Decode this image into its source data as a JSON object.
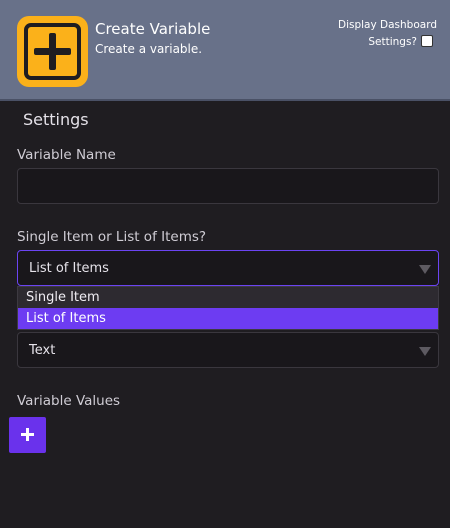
{
  "header": {
    "title": "Create Variable",
    "subtitle": "Create a variable.",
    "icon": "add-square-icon",
    "icon_color": "#fbb11a",
    "display_dashboard_label_line1": "Display Dashboard",
    "display_dashboard_label_line2": "Settings?",
    "display_dashboard_checked": false
  },
  "settings": {
    "heading": "Settings",
    "variable_name": {
      "label": "Variable Name",
      "value": "",
      "placeholder": ""
    },
    "single_or_list": {
      "label": "Single Item or List of Items?",
      "selected": "List of Items",
      "options": [
        "Single Item",
        "List of Items"
      ]
    },
    "type_select": {
      "selected": "Text"
    },
    "variable_values": {
      "label": "Variable Values",
      "add_button_icon": "plus-icon"
    }
  },
  "colors": {
    "header_bg": "#687189",
    "accent": "#6a32ec",
    "panel_bg": "#1f1d21"
  }
}
